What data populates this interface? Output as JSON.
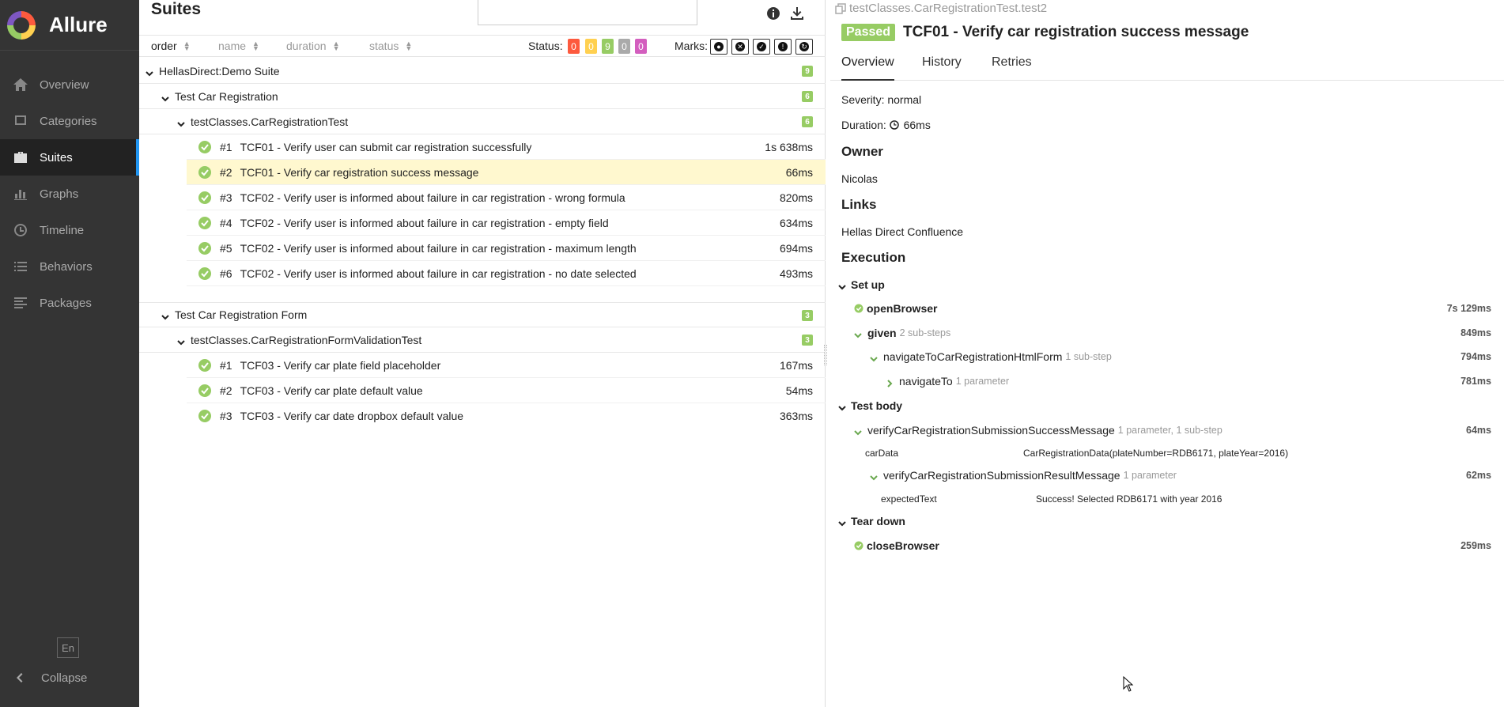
{
  "app": {
    "name": "Allure",
    "language": "En",
    "collapse_label": "Collapse"
  },
  "sidebar": {
    "items": [
      {
        "label": "Overview",
        "icon": "home-icon"
      },
      {
        "label": "Categories",
        "icon": "flag-icon"
      },
      {
        "label": "Suites",
        "icon": "briefcase-icon",
        "active": true
      },
      {
        "label": "Graphs",
        "icon": "bar-chart-icon"
      },
      {
        "label": "Timeline",
        "icon": "clock-icon"
      },
      {
        "label": "Behaviors",
        "icon": "list-icon"
      },
      {
        "label": "Packages",
        "icon": "align-left-icon"
      }
    ]
  },
  "suites": {
    "title": "Suites",
    "search_value": "",
    "sort": {
      "order": "order",
      "name": "name",
      "duration": "duration",
      "status": "status"
    },
    "status_label": "Status:",
    "status_counts": [
      {
        "value": "0",
        "color": "#fd5a3e"
      },
      {
        "value": "0",
        "color": "#ffd050"
      },
      {
        "value": "9",
        "color": "#97cc64"
      },
      {
        "value": "0",
        "color": "#aaaaaa"
      },
      {
        "value": "0",
        "color": "#d35ebe"
      }
    ],
    "marks_label": "Marks:",
    "root": {
      "name": "HellasDirect:Demo Suite",
      "count": "9"
    },
    "group1": {
      "name": "Test Car Registration",
      "count": "6"
    },
    "class1": {
      "name": "testClasses.CarRegistrationTest",
      "count": "6"
    },
    "tests1": [
      {
        "num": "#1",
        "name": "TCF01 - Verify user can submit car registration successfully",
        "duration": "1s 638ms"
      },
      {
        "num": "#2",
        "name": "TCF01 - Verify car registration success message",
        "duration": "66ms"
      },
      {
        "num": "#3",
        "name": "TCF02 - Verify user is informed about failure in car registration - wrong formula",
        "duration": "820ms"
      },
      {
        "num": "#4",
        "name": "TCF02 - Verify user is informed about failure in car registration - empty field",
        "duration": "634ms"
      },
      {
        "num": "#5",
        "name": "TCF02 - Verify user is informed about failure in car registration - maximum length",
        "duration": "694ms"
      },
      {
        "num": "#6",
        "name": "TCF02 - Verify user is informed about failure in car registration - no date selected",
        "duration": "493ms"
      }
    ],
    "group2": {
      "name": "Test Car Registration Form",
      "count": "3"
    },
    "class2": {
      "name": "testClasses.CarRegistrationFormValidationTest",
      "count": "3"
    },
    "tests2": [
      {
        "num": "#1",
        "name": "TCF03 - Verify car plate field placeholder",
        "duration": "167ms"
      },
      {
        "num": "#2",
        "name": "TCF03 - Verify car plate default value",
        "duration": "54ms"
      },
      {
        "num": "#3",
        "name": "TCF03 - Verify car date dropbox default value",
        "duration": "363ms"
      }
    ]
  },
  "testresult": {
    "breadcrumb": "testClasses.CarRegistrationTest.test2",
    "status": "Passed",
    "title": "TCF01 - Verify car registration success message",
    "tabs": [
      "Overview",
      "History",
      "Retries"
    ],
    "severity": "Severity: normal",
    "duration_label": "Duration:",
    "duration_value": "66ms",
    "owner_heading": "Owner",
    "owner": "Nicolas",
    "links_heading": "Links",
    "link": "Hellas Direct Confluence",
    "execution_heading": "Execution",
    "setup": {
      "label": "Set up",
      "step1": {
        "name": "openBrowser",
        "duration": "7s 129ms"
      },
      "step2": {
        "name": "given",
        "meta": "2 sub-steps",
        "duration": "849ms"
      },
      "step3": {
        "name": "navigateToCarRegistrationHtmlForm",
        "meta": "1 sub-step",
        "duration": "794ms"
      },
      "step4": {
        "name": "navigateTo",
        "meta": "1 parameter",
        "duration": "781ms"
      }
    },
    "body": {
      "label": "Test body",
      "step1": {
        "name": "verifyCarRegistrationSubmissionSuccessMessage",
        "meta": "1 parameter, 1 sub-step",
        "duration": "64ms"
      },
      "param1": {
        "name": "carData",
        "value": "CarRegistrationData(plateNumber=RDB6171, plateYear=2016)"
      },
      "step2": {
        "name": "verifyCarRegistrationSubmissionResultMessage",
        "meta": "1 parameter",
        "duration": "62ms"
      },
      "param2": {
        "name": "expectedText",
        "value": "Success! Selected RDB6171 with year 2016"
      }
    },
    "teardown": {
      "label": "Tear down",
      "step1": {
        "name": "closeBrowser",
        "duration": "259ms"
      }
    }
  }
}
